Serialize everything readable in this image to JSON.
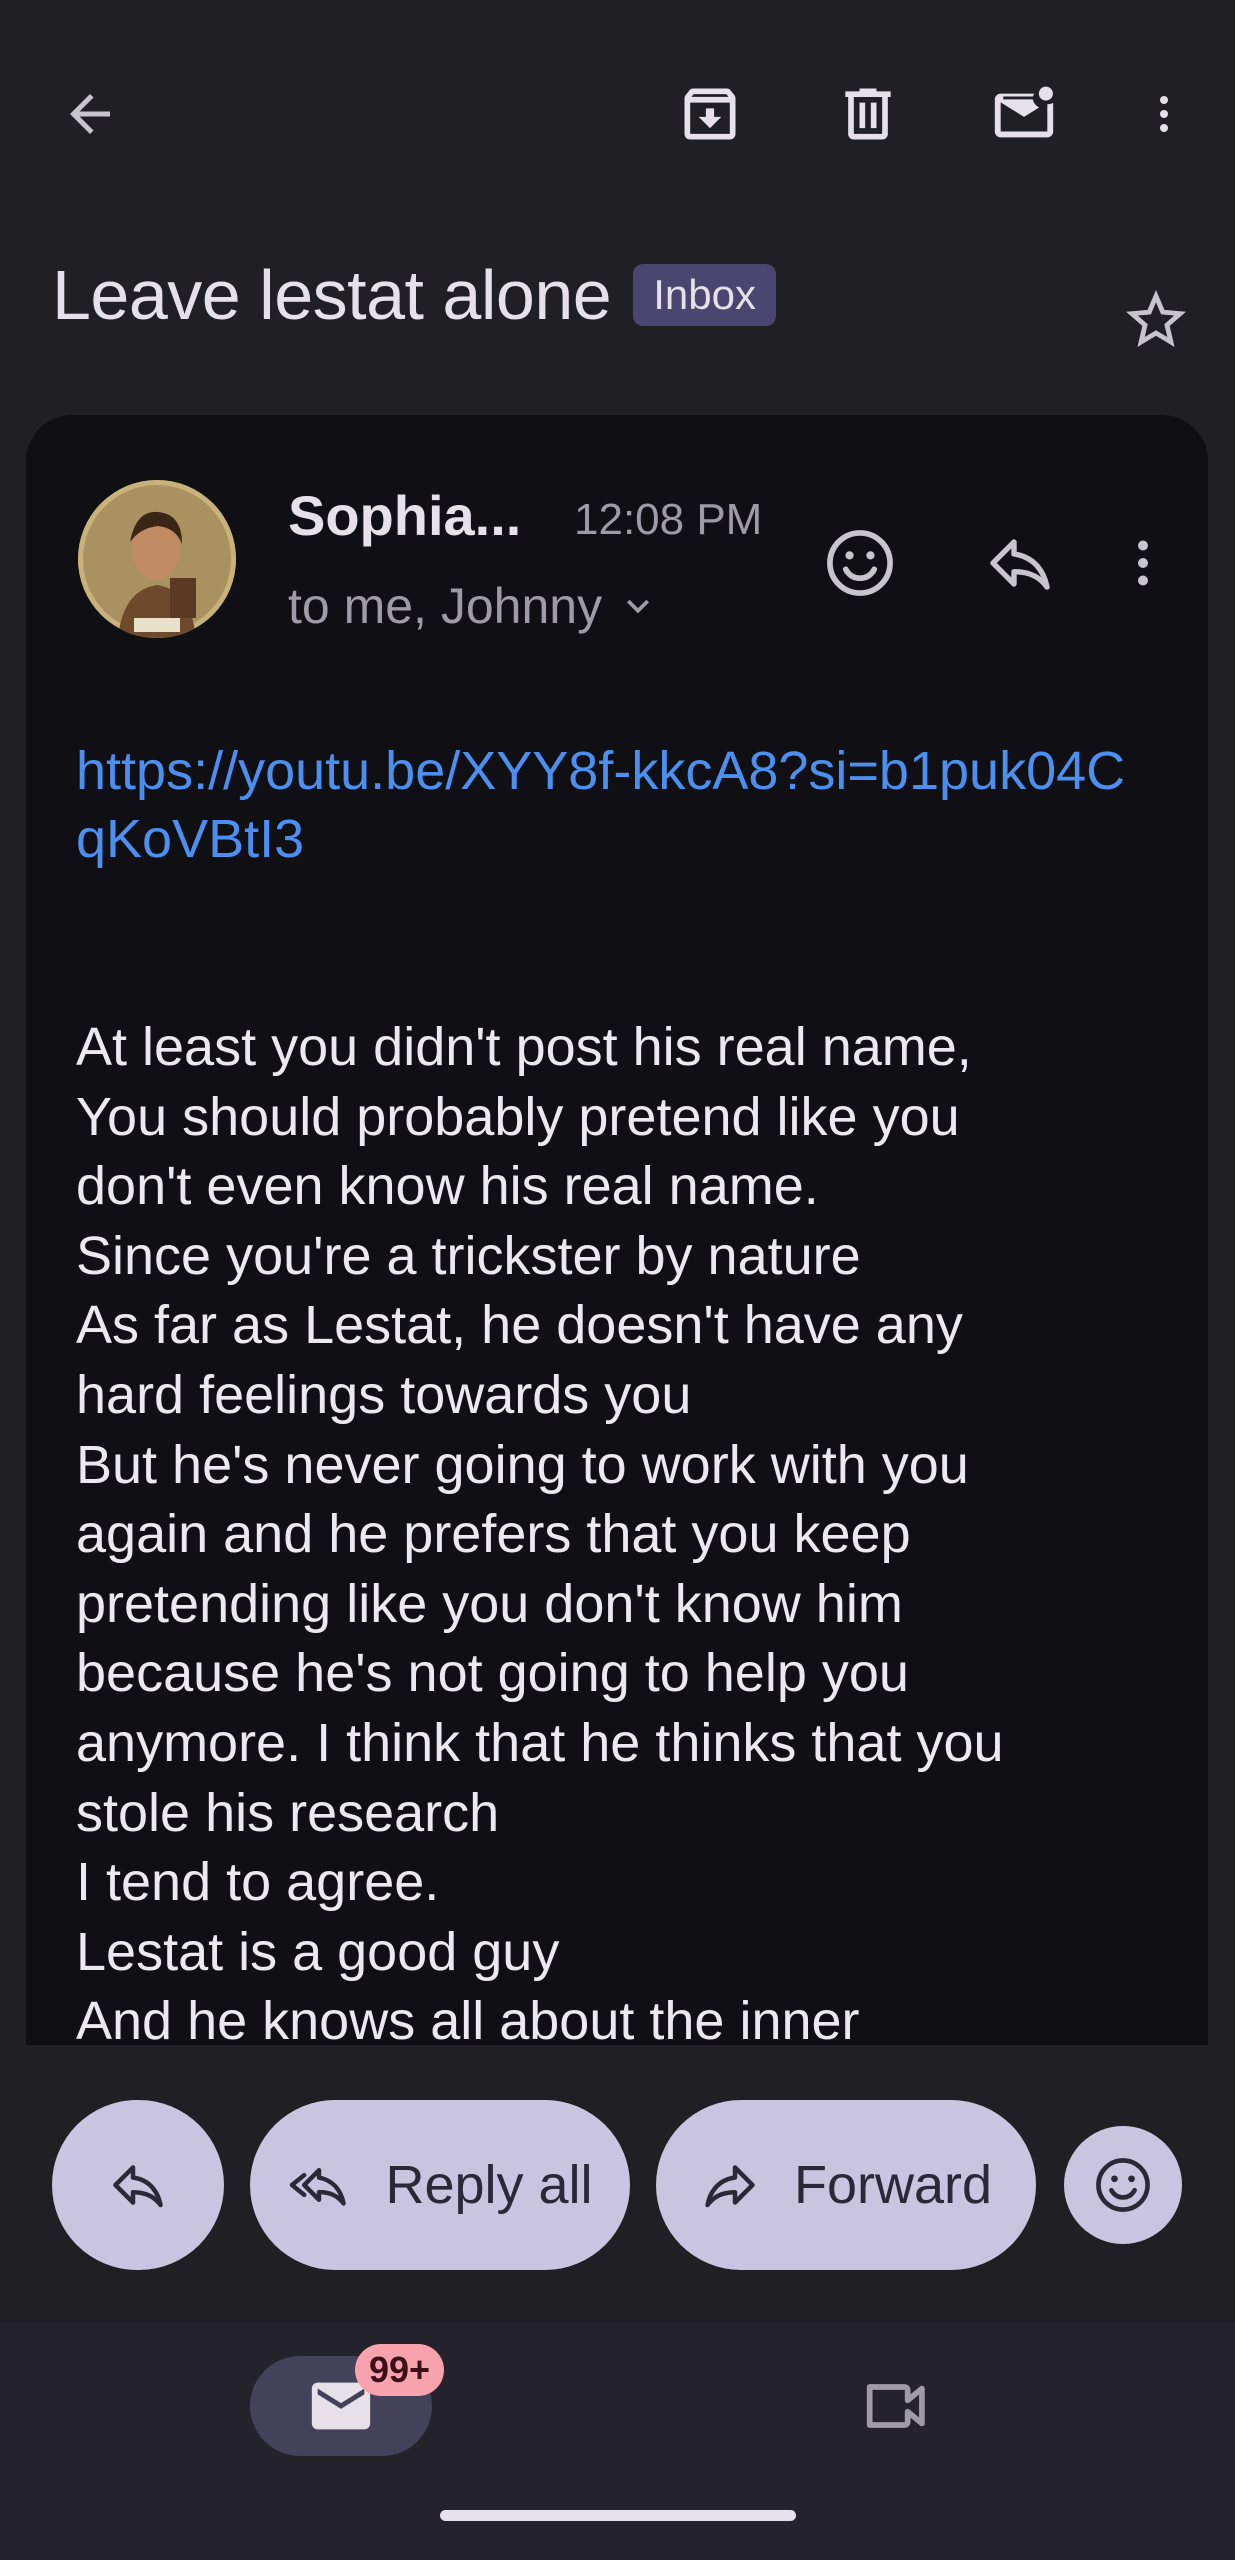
{
  "toolbar": {
    "back_icon": "arrow-back-icon",
    "archive_icon": "archive-icon",
    "delete_icon": "trash-icon",
    "mark_unread_icon": "mark-unread-icon",
    "more_icon": "more-vertical-icon"
  },
  "subject": {
    "title": "Leave lestat alone",
    "label_chip": "Inbox",
    "star_icon": "star-outline-icon"
  },
  "message": {
    "sender": "Sophia...",
    "time": "12:08 PM",
    "recipients": "to me, Johnny",
    "link": "https://youtu.be/XYY8f-kkcA8?si=b1puk04CqKoVBtI3",
    "body_lines": [
      "At least you didn't post his real name,",
      "You should probably pretend like you",
      "don't even know his real name.",
      "Since you're a trickster by nature",
      "As far as Lestat, he doesn't have any",
      "hard feelings towards you",
      "But he's never going to work with you",
      "again and he prefers that you keep",
      "pretending like you don't know him",
      "because he's not going to help you",
      "anymore. I think that he thinks that you",
      "stole his research",
      "I tend to agree.",
      "Lestat is a good guy",
      "And he knows all about the inner"
    ]
  },
  "actions": {
    "reply_all_label": "Reply all",
    "forward_label": "Forward"
  },
  "bottom_nav": {
    "mail_badge": "99+"
  },
  "colors": {
    "background": "#1f1f24",
    "card": "#101014",
    "link": "#4b8ff0",
    "pill": "#c9c5e0",
    "badge": "#f6a3ad"
  }
}
